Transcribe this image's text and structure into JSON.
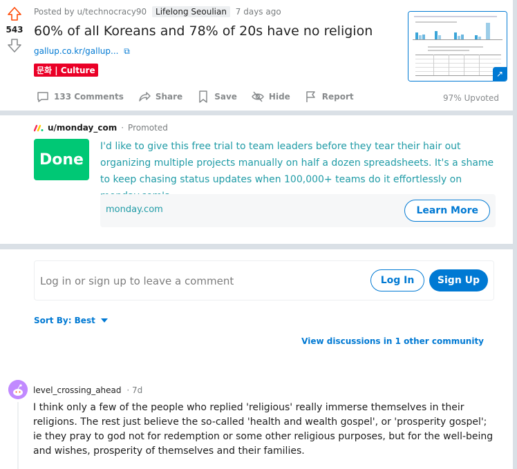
{
  "post": {
    "vote_count": "543",
    "posted_by": "Posted by u/technocracy90",
    "user_flair": "Lifelong Seoulian",
    "time_ago": "7 days ago",
    "title": "60% of all Koreans and 78% of 20s have no religion",
    "link": "gallup.co.kr/gallup...",
    "link_flair": "문화 | Culture",
    "actions": {
      "comments": "133 Comments",
      "share": "Share",
      "save": "Save",
      "hide": "Hide",
      "report": "Report"
    },
    "upvoted": "97% Upvoted"
  },
  "promo": {
    "user": "u/monday_com",
    "label": "Promoted",
    "logo_text": "Done",
    "body": "I'd like to give this free trial to team leaders before they tear their hair out organizing multiple projects manually on half a dozen spreadsheets. It's a shame to keep chasing status updates when 100,000+ teams do it effortlessly on monday.com's...",
    "domain": "monday.com",
    "cta": "Learn More"
  },
  "comments_section": {
    "login_prompt": "Log in or sign up to leave a comment",
    "login_button": "Log In",
    "signup_button": "Sign Up",
    "sort_label": "Sort By: Best",
    "view_discussions": "View discussions in 1 other community"
  },
  "comment": {
    "author": "level_crossing_ahead",
    "time": "· 7d",
    "body": "I think only a few of the people who replied 'religious' really immerse themselves in their religions. The rest just believe the so-called 'health and wealth gospel', or 'prosperity gospel'; ie they pray to god not for redemption or some other religious purposes, but for the well-being and wishes, prosperity of themselves and their families."
  },
  "colors": {
    "accent": "#0079d3",
    "flair_red": "#ea0027",
    "promo_green": "#00c875",
    "promo_text": "#1f9ba6",
    "upvote_orange": "#ff4500"
  }
}
